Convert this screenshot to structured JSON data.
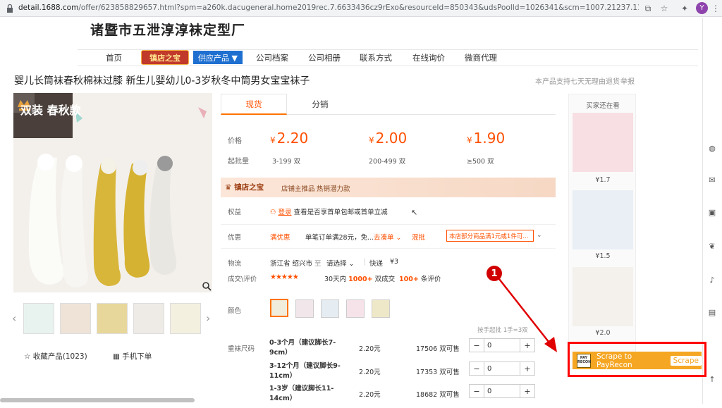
{
  "browser": {
    "url_host": "detail.1688.com",
    "url_path": "/offer/623858829657.html?spm=a260k.dacugeneral.home2019rec.7.6633436cz9rExo&resourceId=850343&udsPoolId=1026341&scm=1007.21237.114566.0&pvid=e3093a31-...",
    "avatar_letter": "Y"
  },
  "store": {
    "name": "诸暨市五泄淳淳袜定型厂",
    "nav": [
      "首页",
      "供应产品 ▼",
      "公司档案",
      "公司相册",
      "联系方式",
      "在线询价",
      "微商代理"
    ],
    "badge": "镇店之宝"
  },
  "product": {
    "title": "婴儿长筒袜春秋棉袜过膝 新生儿婴幼儿0-3岁秋冬中筒男女宝宝袜子",
    "note_7day": "本产品支持七天无理由退货",
    "report": "举报",
    "image_caption": "双装 春秋款",
    "favorites": "收藏产品(1023)",
    "mobile_order": "手机下单"
  },
  "tabs": [
    "现货",
    "分销"
  ],
  "pricing": {
    "price_label": "价格",
    "moq_label": "起批量",
    "tiers": [
      {
        "price": "2.20",
        "range": "3-199 双"
      },
      {
        "price": "2.00",
        "range": "200-499 双"
      },
      {
        "price": "1.90",
        "range": "≥500 双"
      }
    ],
    "currency": "¥"
  },
  "shop_bar": {
    "logo": "镇店之宝",
    "text1": "店铺主推品",
    "text2": "热销潜力款"
  },
  "rows": {
    "rights_label": "权益",
    "rights_link": "登录",
    "rights_text": "查看是否享首单包邮或首单立减",
    "promo_label": "优惠",
    "promo_tag1": "满优惠",
    "promo_text1": "单笔订单满28元，免...",
    "promo_more": "去凑单 ⌄",
    "promo_tag2": "混批",
    "promo_text2": "本店部分商品满1元或1件可...",
    "ship_label": "物流",
    "ship_from": "浙江省 绍兴市",
    "ship_to_label": "至",
    "ship_select": "请选择 ⌄",
    "ship_method": "快递",
    "ship_fee": "¥3",
    "deal_label": "成交\\评价",
    "stars": "★★★★★",
    "deal_prefix": "30天内",
    "deal_count": "1000+",
    "deal_suffix": "双成交",
    "review_count": "100+",
    "review_suffix": "条评价",
    "color_label": "颜色",
    "batch_note": "按手起批 1手=3双",
    "size_label": "重袜尺码"
  },
  "sku_rows": [
    {
      "name": "0-3个月（建议脚长7-9cm）",
      "price": "2.20元",
      "stock": "17506 双可售",
      "qty": "0"
    },
    {
      "name": "3-12个月（建议脚长9-11cm）",
      "price": "2.20元",
      "stock": "17353 双可售",
      "qty": "0"
    },
    {
      "name": "1-3岁（建议脚长11-14cm）",
      "price": "2.20元",
      "stock": "18682 双可售",
      "qty": "0"
    }
  ],
  "rail": {
    "title": "买家还在看",
    "prices": [
      "¥1.7",
      "¥1.5",
      "¥2.0"
    ]
  },
  "annotation": {
    "marker": "1",
    "scrape_label": "Scrape to PayRecon",
    "scrape_mini": "Scrape",
    "logo_text": "PAY RECON"
  },
  "colors": {
    "accent": "#ff5000",
    "scrape_orange": "#f5a623",
    "annotation_red": "#ff0000"
  }
}
